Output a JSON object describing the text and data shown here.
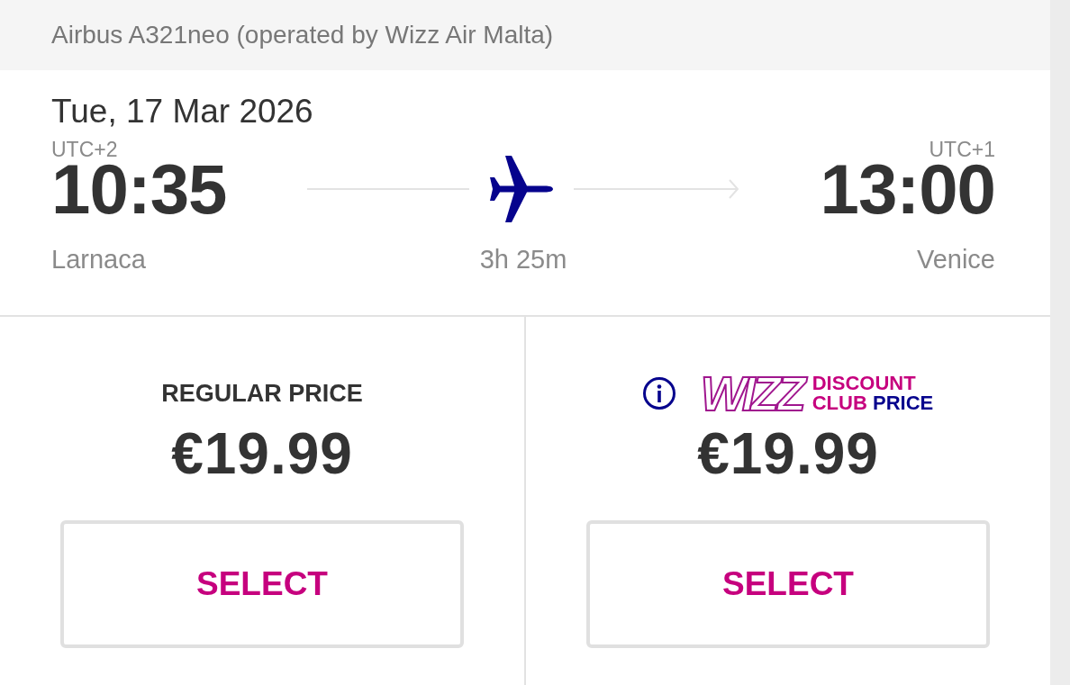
{
  "aircraft_info": "Airbus A321neo (operated by Wizz Air Malta)",
  "flight": {
    "date": "Tue, 17 Mar 2026",
    "departure": {
      "timezone": "UTC+2",
      "time": "10:35",
      "city": "Larnaca"
    },
    "duration": "3h 25m",
    "arrival": {
      "timezone": "UTC+1",
      "time": "13:00",
      "city": "Venice"
    }
  },
  "fares": [
    {
      "kind": "regular",
      "label": "REGULAR PRICE",
      "price": "€19.99",
      "button": "SELECT"
    },
    {
      "kind": "club",
      "logo": "WIZZ",
      "label_lines": [
        [
          {
            "text": "DISCOUNT",
            "color": "#c6007e"
          }
        ],
        [
          {
            "text": "CLUB",
            "color": "#c6007e"
          },
          {
            "text": "PRICE",
            "color": "#06038d"
          }
        ]
      ],
      "price": "€19.99",
      "button": "SELECT"
    }
  ]
}
